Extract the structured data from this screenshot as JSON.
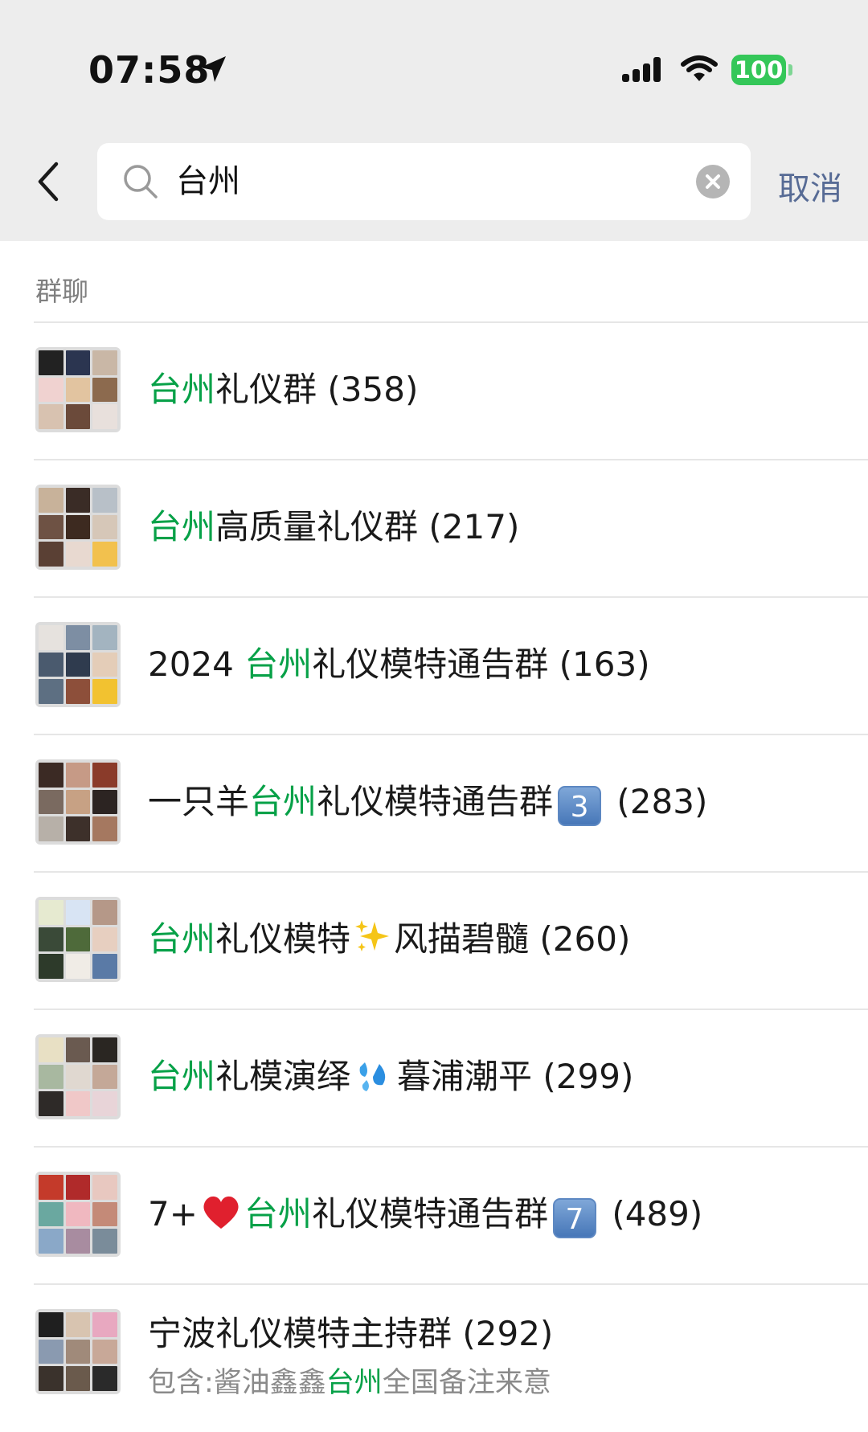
{
  "status_bar": {
    "time": "07:58",
    "battery": "100",
    "icons": [
      "location-arrow-icon",
      "signal-icon",
      "wifi-icon",
      "battery-icon"
    ]
  },
  "search": {
    "query": "台州",
    "cancel_label": "取消"
  },
  "section": {
    "title": "群聊"
  },
  "groups": [
    {
      "pre": "",
      "match": "台州",
      "post": "礼仪群",
      "emoji": "",
      "post2": "",
      "count": "(358)",
      "sub": null
    },
    {
      "pre": "",
      "match": "台州",
      "post": "高质量礼仪群",
      "emoji": "",
      "post2": "",
      "count": "(217)",
      "sub": null
    },
    {
      "pre": "2024 ",
      "match": "台州",
      "post": "礼仪模特通告群",
      "emoji": "",
      "post2": "",
      "count": "(163)",
      "sub": null
    },
    {
      "pre": "一只羊",
      "match": "台州",
      "post": "礼仪模特通告群",
      "emoji": "keycap-3",
      "post2": "",
      "count": "(283)",
      "sub": null
    },
    {
      "pre": "",
      "match": "台州",
      "post": "礼仪模特",
      "emoji": "sparkles",
      "post2": "风描碧髓",
      "count": "(260)",
      "sub": null
    },
    {
      "pre": "",
      "match": "台州",
      "post": "礼模演绎",
      "emoji": "droplets",
      "post2": "暮浦潮平",
      "count": "(299)",
      "sub": null
    },
    {
      "pre": "7+",
      "emoji_pre": "heart",
      "match": "台州",
      "post": "礼仪模特通告群",
      "emoji": "keycap-7",
      "post2": "",
      "count": "(489)",
      "sub": null
    },
    {
      "pre": "宁波礼仪模特主持群",
      "match": "",
      "post": "",
      "emoji": "",
      "post2": "",
      "count": "(292)",
      "sub": {
        "pre": "包含:酱油鑫鑫",
        "match": "台州",
        "post": "全国备注来意"
      }
    }
  ],
  "colors": {
    "highlight": "#07a148",
    "cancel": "#576b95",
    "header_bg": "#ededed",
    "battery": "#34c759"
  }
}
